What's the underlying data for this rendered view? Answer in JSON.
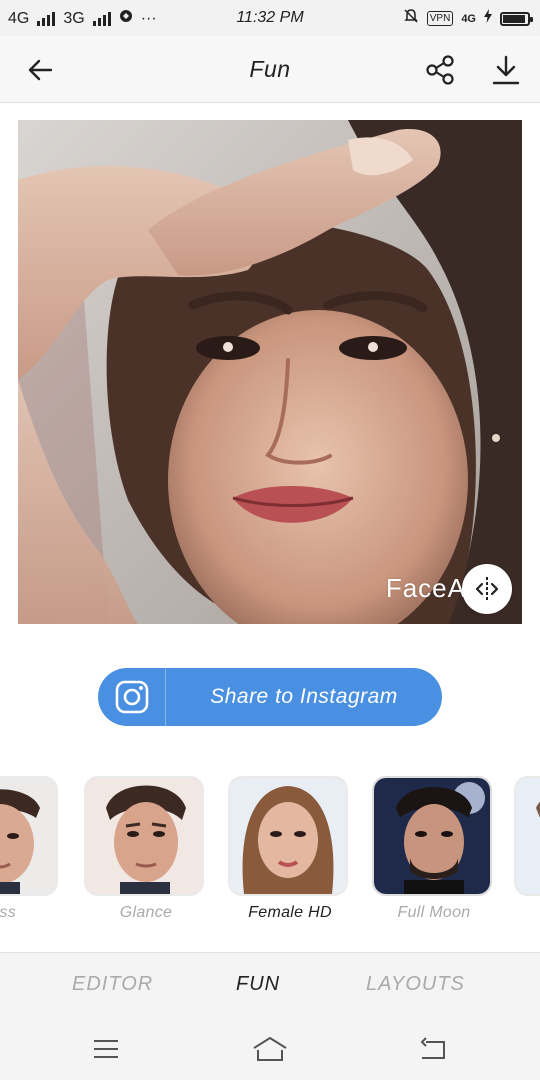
{
  "status_bar": {
    "network1": "4G",
    "network2": "3G",
    "more": "···",
    "time": "11:32 PM",
    "vpn": "VPN",
    "lte": "4G"
  },
  "header": {
    "title": "Fun",
    "back_icon": "arrow-left-icon",
    "share_icon": "share-icon",
    "download_icon": "download-icon"
  },
  "photo": {
    "watermark": "FaceA",
    "compare_icon": "compare-icon"
  },
  "share": {
    "label": "Share to Instagram",
    "icon": "instagram-icon"
  },
  "filters": [
    {
      "label": "ss",
      "active": false
    },
    {
      "label": "Glance",
      "active": false
    },
    {
      "label": "Female HD",
      "active": true
    },
    {
      "label": "Full Moon",
      "active": false
    },
    {
      "label": "",
      "active": false
    }
  ],
  "tabs": [
    {
      "label": "EDITOR",
      "active": false
    },
    {
      "label": "FUN",
      "active": true
    },
    {
      "label": "LAYOUTS",
      "active": false
    }
  ],
  "colors": {
    "accent": "#4a90e2",
    "inactive_text": "#aaaaaa",
    "active_text": "#222222"
  }
}
